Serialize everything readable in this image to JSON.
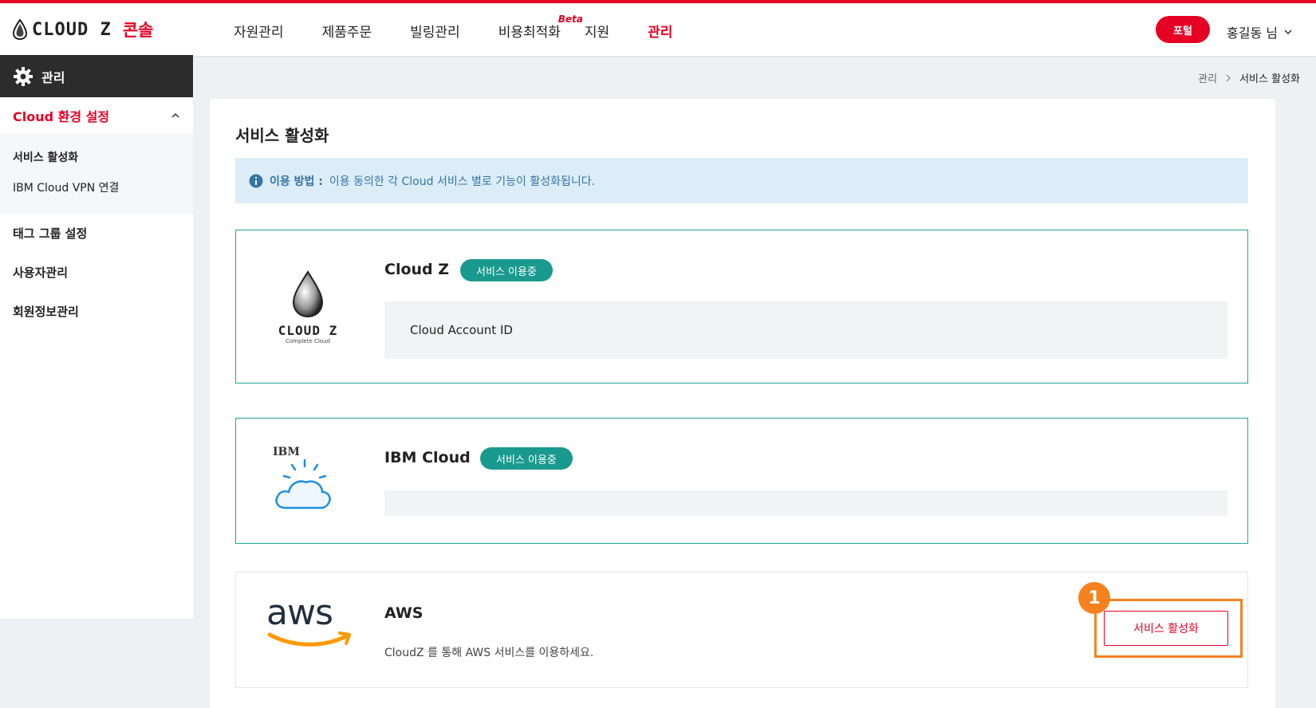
{
  "header": {
    "logo_text": "CLOUD Z",
    "logo_console": "콘솔",
    "nav": [
      {
        "label": "자원관리"
      },
      {
        "label": "제품주문"
      },
      {
        "label": "빌링관리"
      },
      {
        "label": "비용최적화",
        "badge": "Beta"
      },
      {
        "label": "지원"
      },
      {
        "label": "관리"
      }
    ],
    "portal_label": "포털",
    "user_label": "홍길동 님"
  },
  "sidebar": {
    "title": "관리",
    "section": "Cloud 환경 설정",
    "sub_items": [
      {
        "label": "서비스 활성화"
      },
      {
        "label": "IBM Cloud VPN 연결"
      }
    ],
    "items": [
      {
        "label": "태그 그룹 설정"
      },
      {
        "label": "사용자관리"
      },
      {
        "label": "회원정보관리"
      }
    ]
  },
  "breadcrumb": {
    "parent": "관리",
    "current": "서비스 활성화"
  },
  "main": {
    "title": "서비스 활성화",
    "info_label": "이용 방법 :",
    "info_text": "이용 동의한 각 Cloud 서비스 별로 기능이 활성화됩니다.",
    "cards": [
      {
        "name": "Cloud Z",
        "badge": "서비스 이용중",
        "field": "Cloud Account ID",
        "logo_text": "CLOUD Z",
        "logo_sub": "Complete Cloud"
      },
      {
        "name": "IBM Cloud",
        "badge": "서비스 이용중",
        "field": "",
        "logo_text": "IBM"
      },
      {
        "name": "AWS",
        "description": "CloudZ 를 통해 AWS 서비스를 이용하세요.",
        "button": "서비스 활성화",
        "logo_text": "aws"
      }
    ],
    "step_number": "1"
  },
  "colors": {
    "brand": "#e60023",
    "teal": "#1a9a8e",
    "highlight": "#f5821f"
  }
}
